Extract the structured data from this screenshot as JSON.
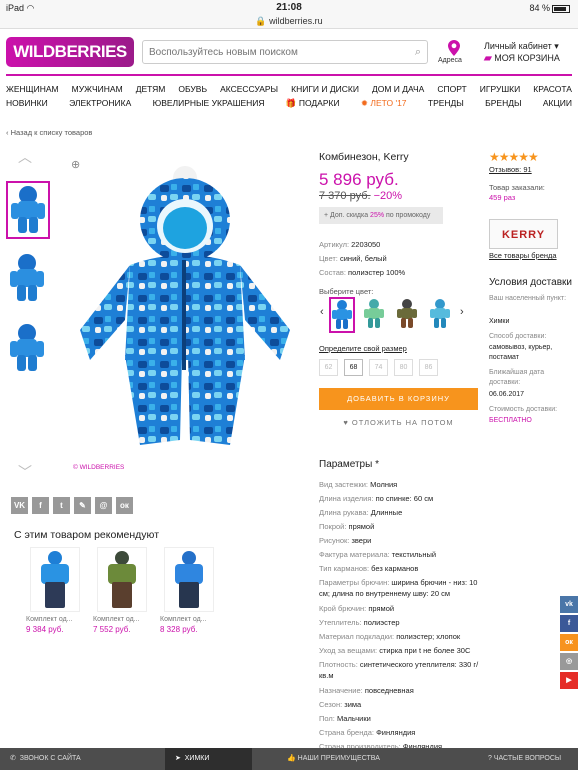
{
  "status": {
    "device": "iPad",
    "time": "21:08",
    "url": "wildberries.ru",
    "battery": "84 %"
  },
  "header": {
    "logo": "WILDBERRIES",
    "search_placeholder": "Воспользуйтесь новым поиском",
    "address": "Адреса",
    "account": "Личный кабинет",
    "cart": "МОЯ КОРЗИНА"
  },
  "nav1": [
    "ЖЕНЩИНАМ",
    "МУЖЧИНАМ",
    "ДЕТЯМ",
    "ОБУВЬ",
    "АКСЕССУАРЫ",
    "КНИГИ И ДИСКИ",
    "ДОМ И ДАЧА",
    "СПОРТ",
    "ИГРУШКИ",
    "КРАСОТА"
  ],
  "nav2": [
    "НОВИНКИ",
    "ЭЛЕКТРОНИКА",
    "ЮВЕЛИРНЫЕ УКРАШЕНИЯ",
    "ПОДАРКИ",
    "ЛЕТО '17",
    "ТРЕНДЫ",
    "БРЕНДЫ",
    "АКЦИИ"
  ],
  "back": "Назад к списку товаров",
  "copyright": "© WILDBERRIES",
  "social": [
    "VK",
    "f",
    "t",
    "✎",
    "@",
    "ок"
  ],
  "recommend": {
    "title": "С этим товаром рекомендуют",
    "items": [
      {
        "name": "Комплект од...",
        "price": "9 384 руб."
      },
      {
        "name": "Комплект од...",
        "price": "7 552 руб."
      },
      {
        "name": "Комплект од...",
        "price": "8 328 руб."
      }
    ]
  },
  "product": {
    "title": "Комбинезон, Kerry",
    "price": "5 896 руб.",
    "old_price": "7 370 руб.",
    "discount": "−20%",
    "promo_pre": "+ Доп. скидка ",
    "promo_pct": "25%",
    "promo_post": " по промокоду",
    "article_label": "Артикул: ",
    "article": "2203050",
    "color_label": "Цвет: ",
    "color": "синий, белый",
    "composition_label": "Состав: ",
    "composition": "полиэстер 100%",
    "choose_color": "Выберите цвет:",
    "size_label": "Определите свой размер",
    "sizes": [
      "62",
      "68",
      "74",
      "80",
      "86"
    ],
    "add_to_cart": "ДОБАВИТЬ В КОРЗИНУ",
    "later": "ОТЛОЖИТЬ НА ПОТОМ"
  },
  "side": {
    "stars": "★★★★★",
    "reviews": "Отзывов: 91",
    "ordered_label": "Товар заказали:",
    "ordered": "459 раз",
    "brand_logo": "KERRY",
    "all_brand": "Все товары бренда",
    "delivery_title": "Условия доставки",
    "city_label": "Ваш населенный пункт:",
    "city": "Химки",
    "method_label": "Способ доставки:",
    "method": "самовывоз, курьер, постамат",
    "date_label": "Ближайшая дата доставки:",
    "date": "06.06.2017",
    "cost_label": "Стоимость доставки:",
    "cost": "БЕСПЛАТНО"
  },
  "params": {
    "title": "Параметры *",
    "rows": [
      {
        "k": "Вид застежки: ",
        "v": "Молния"
      },
      {
        "k": "Длина изделия: ",
        "v": "по спинке: 60 см"
      },
      {
        "k": "Длина рукава: ",
        "v": "Длинные"
      },
      {
        "k": "Покрой: ",
        "v": "прямой"
      },
      {
        "k": "Рисунок: ",
        "v": "звери"
      },
      {
        "k": "Фактура материала: ",
        "v": "текстильный"
      },
      {
        "k": "Тип карманов: ",
        "v": "без карманов"
      },
      {
        "k": "Параметры брючин: ",
        "v": "ширина брючин - низ: 10 см; длина по внутреннему шву: 20 см"
      },
      {
        "k": "Крой брючин: ",
        "v": "прямой"
      },
      {
        "k": "Утеплитель: ",
        "v": "полиэстер"
      },
      {
        "k": "Материал подкладки: ",
        "v": "полиэстер; хлопок"
      },
      {
        "k": "Уход за вещами: ",
        "v": "стирка при t не более 30С"
      },
      {
        "k": "Плотность: ",
        "v": "синтетического утеплителя: 330 г/кв.м"
      },
      {
        "k": "Назначение: ",
        "v": "повседневная"
      },
      {
        "k": "Сезон: ",
        "v": "зима"
      },
      {
        "k": "Пол: ",
        "v": "Мальчики"
      },
      {
        "k": "Страна бренда: ",
        "v": "Финляндия"
      },
      {
        "k": "Страна производитель: ",
        "v": "Финляндия"
      }
    ]
  },
  "footer": {
    "call": "ЗВОНОК С САЙТА",
    "location": "ХИМКИ",
    "advantages": "НАШИ ПРЕИМУЩЕСТВА",
    "faq": "ЧАСТЫЕ ВОПРОСЫ"
  },
  "colors": {
    "accent": "#cb11ab",
    "orange": "#f7941d"
  }
}
